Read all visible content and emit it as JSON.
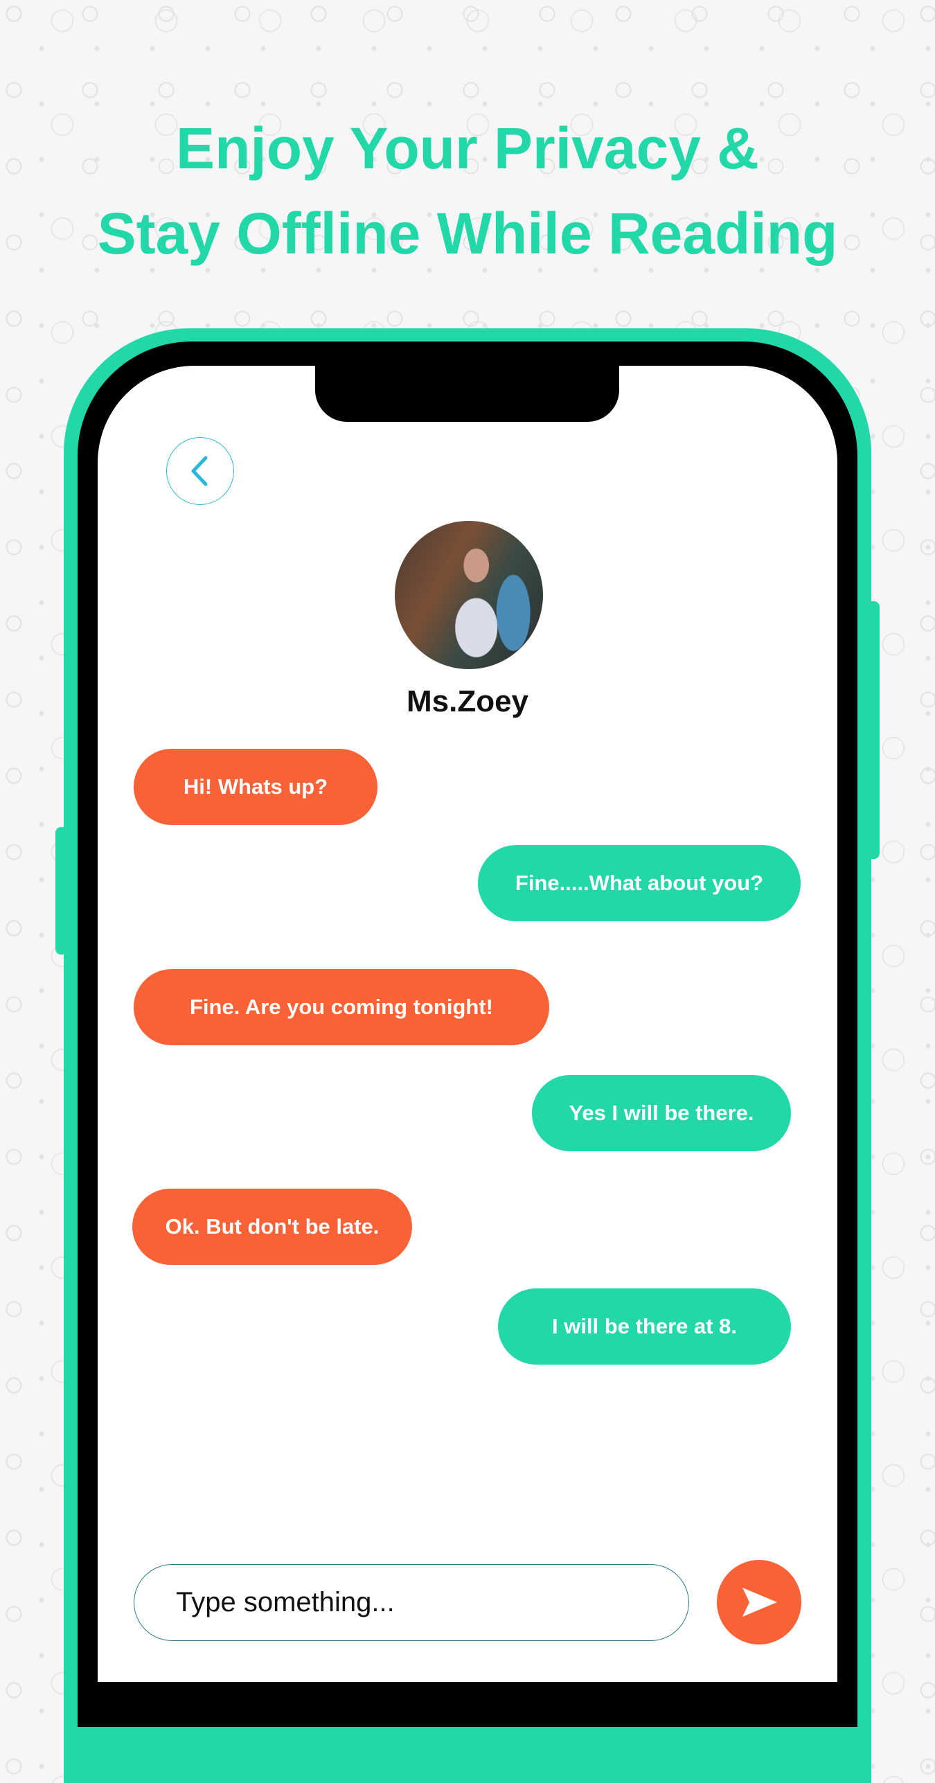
{
  "headline": {
    "line1": "Enjoy Your Privacy &",
    "line2": "Stay Offline While Reading"
  },
  "colors": {
    "accent_green": "#22d8a9",
    "accent_orange": "#f96236",
    "back_icon": "#2ab8d8"
  },
  "chat": {
    "contact_name": "Ms.Zoey",
    "messages": [
      {
        "side": "received",
        "text": "Hi! Whats up?"
      },
      {
        "side": "sent",
        "text": "Fine.....What about you?"
      },
      {
        "side": "received",
        "text": "Fine. Are you coming tonight!"
      },
      {
        "side": "sent",
        "text": "Yes I will be there."
      },
      {
        "side": "received",
        "text": "Ok. But don't be late."
      },
      {
        "side": "sent",
        "text": "I will be there at 8."
      }
    ],
    "input_placeholder": "Type something...",
    "icons": {
      "back": "chevron-left-icon",
      "send": "send-icon"
    }
  }
}
